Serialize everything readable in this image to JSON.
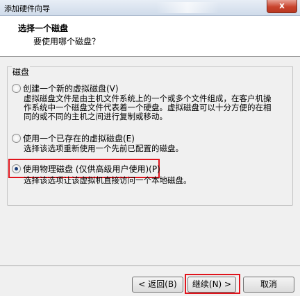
{
  "window": {
    "title": "添加硬件向导",
    "close_glyph": "x"
  },
  "header": {
    "title": "选择一个磁盘",
    "subtitle": "要使用哪个磁盘？"
  },
  "group": {
    "label": "磁盘"
  },
  "options": [
    {
      "label": "创建一个新的虚拟磁盘(V)",
      "selected": false,
      "desc_lines": [
        "虚拟磁盘文件是由主机文件系统上的一个或多个文件组成，在客户机操",
        "作系统中一个磁盘文件代表着一个硬盘。虚拟磁盘可以十分方便的在相",
        "同的或不同的主机之间进行复制或移动。"
      ]
    },
    {
      "label": "使用一个已存在的虚拟磁盘(E)",
      "selected": false,
      "desc_lines": [
        "选择该选项重新使用一个先前已配置的磁盘。"
      ]
    },
    {
      "label": "使用物理磁盘 (仅供高级用户使用)(P)",
      "selected": true,
      "desc_lines": [
        "选择该选项让该虚拟机直接访问一个本地磁盘。"
      ]
    }
  ],
  "buttons": {
    "back": "< 返回(B)",
    "next": "继续(N) >",
    "cancel": "取消"
  },
  "colors": {
    "highlight": "#e0141c",
    "accent": "#1c3f7a"
  }
}
